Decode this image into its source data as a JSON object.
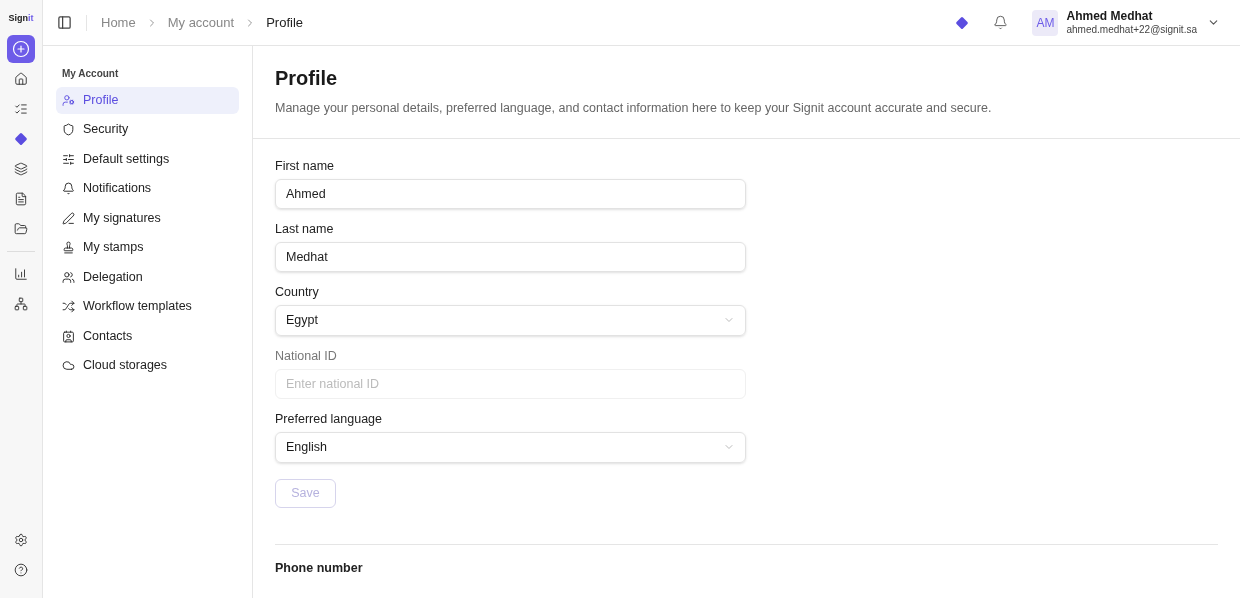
{
  "logo": {
    "text": "Sign",
    "accent": "it"
  },
  "rail": {
    "top": [
      {
        "selected": true
      },
      {
        "selected": false
      },
      {
        "selected": false
      },
      {
        "selected": false
      },
      {
        "selected": false
      },
      {
        "selected": false
      },
      {
        "selected": false
      }
    ],
    "middle": [
      {
        "selected": false
      },
      {
        "selected": false
      }
    ],
    "bottom": [
      {
        "selected": false
      },
      {
        "selected": false
      }
    ]
  },
  "breadcrumbs": [
    {
      "label": "Home",
      "current": false
    },
    {
      "label": "My account",
      "current": false
    },
    {
      "label": "Profile",
      "current": true
    }
  ],
  "user": {
    "initials": "AM",
    "name": "Ahmed Medhat",
    "email": "ahmed.medhat+22@signit.sa"
  },
  "submenu": {
    "title": "My Account",
    "items": [
      {
        "label": "Profile",
        "selected": true
      },
      {
        "label": "Security",
        "selected": false
      },
      {
        "label": "Default settings",
        "selected": false
      },
      {
        "label": "Notifications",
        "selected": false
      },
      {
        "label": "My signatures",
        "selected": false
      },
      {
        "label": "My stamps",
        "selected": false
      },
      {
        "label": "Delegation",
        "selected": false
      },
      {
        "label": "Workflow templates",
        "selected": false
      },
      {
        "label": "Contacts",
        "selected": false
      },
      {
        "label": "Cloud storages",
        "selected": false
      }
    ]
  },
  "page": {
    "title": "Profile",
    "description": "Manage your personal details, preferred language, and contact information here to keep your Signit account accurate and secure."
  },
  "fields": [
    {
      "label": "First name",
      "kind": "text",
      "value": "Ahmed",
      "disabled": false
    },
    {
      "label": "Last name",
      "kind": "text",
      "value": "Medhat",
      "disabled": false
    },
    {
      "label": "Country",
      "kind": "select",
      "value": "Egypt",
      "disabled": false
    },
    {
      "label": "National ID",
      "kind": "text",
      "placeholder": "Enter national ID",
      "disabled": true
    },
    {
      "label": "Preferred language",
      "kind": "select",
      "value": "English",
      "disabled": false
    }
  ],
  "save": {
    "label": "Save",
    "disabled": true
  },
  "next_section": {
    "label": "Phone number"
  }
}
